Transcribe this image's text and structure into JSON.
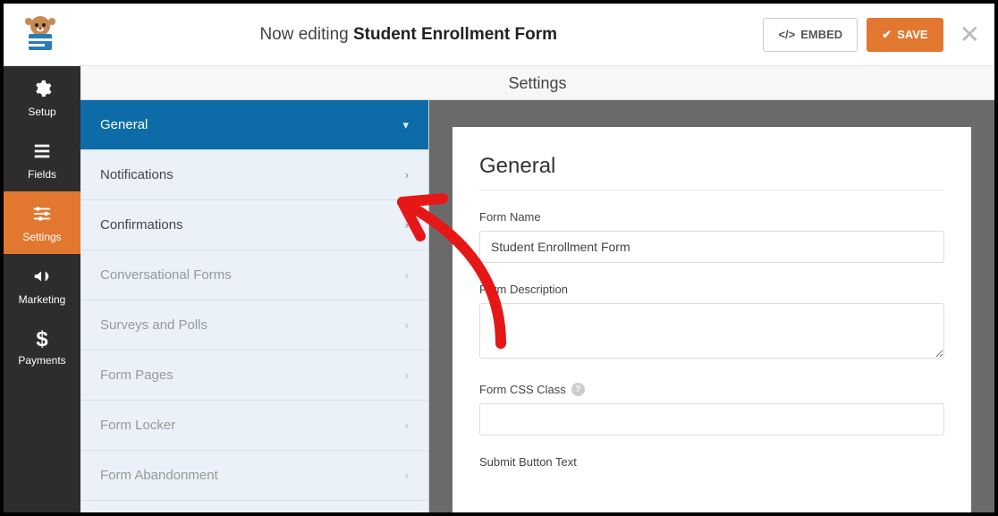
{
  "header": {
    "editing_prefix": "Now editing",
    "form_title": "Student Enrollment Form",
    "embed_label": "EMBED",
    "save_label": "SAVE"
  },
  "leftnav": [
    {
      "label": "Setup",
      "icon": "gear"
    },
    {
      "label": "Fields",
      "icon": "list"
    },
    {
      "label": "Settings",
      "icon": "sliders"
    },
    {
      "label": "Marketing",
      "icon": "bullhorn"
    },
    {
      "label": "Payments",
      "icon": "dollar"
    }
  ],
  "settings_header": "Settings",
  "settings_items": [
    {
      "label": "General",
      "active": true,
      "muted": false
    },
    {
      "label": "Notifications",
      "active": false,
      "muted": false
    },
    {
      "label": "Confirmations",
      "active": false,
      "muted": false
    },
    {
      "label": "Conversational Forms",
      "active": false,
      "muted": true
    },
    {
      "label": "Surveys and Polls",
      "active": false,
      "muted": true
    },
    {
      "label": "Form Pages",
      "active": false,
      "muted": true
    },
    {
      "label": "Form Locker",
      "active": false,
      "muted": true
    },
    {
      "label": "Form Abandonment",
      "active": false,
      "muted": true
    }
  ],
  "panel": {
    "title": "General",
    "form_name_label": "Form Name",
    "form_name_value": "Student Enrollment Form",
    "form_desc_label": "Form Description",
    "form_desc_value": "",
    "form_css_label": "Form CSS Class",
    "form_css_value": "",
    "submit_btn_label": "Submit Button Text"
  }
}
